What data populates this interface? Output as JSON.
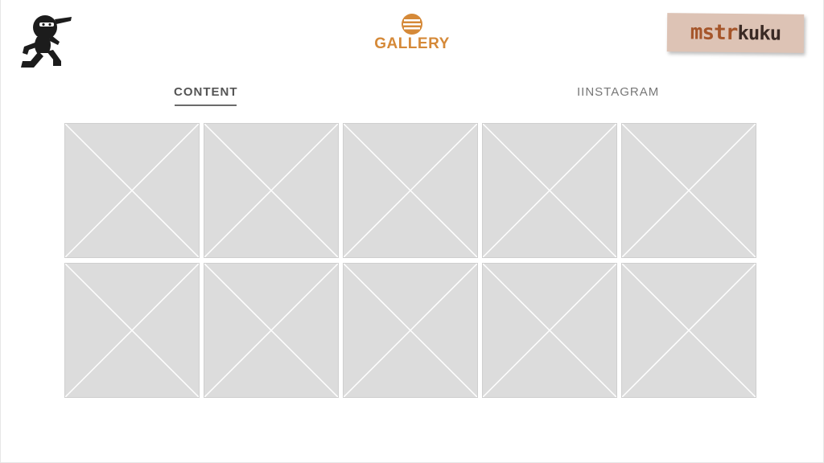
{
  "header": {
    "center_title": "GALLERY",
    "brand_text_part1": "mstr",
    "brand_text_part2": "kuku",
    "mascot_icon": "running-ninja-icon",
    "emblem_icon": "striped-circle-icon"
  },
  "tabs": [
    {
      "label": "CONTENT",
      "active": true
    },
    {
      "label": "IINSTAGRAM",
      "active": false
    }
  ],
  "gallery": {
    "rows": 2,
    "columns": 5,
    "tile_placeholder": "image-placeholder-icon"
  },
  "colors": {
    "accent_orange": "#d58938",
    "brand_background": "#ddc3b5",
    "brand_text_rust": "#a5552a",
    "tile_fill": "#dcdcdc"
  }
}
